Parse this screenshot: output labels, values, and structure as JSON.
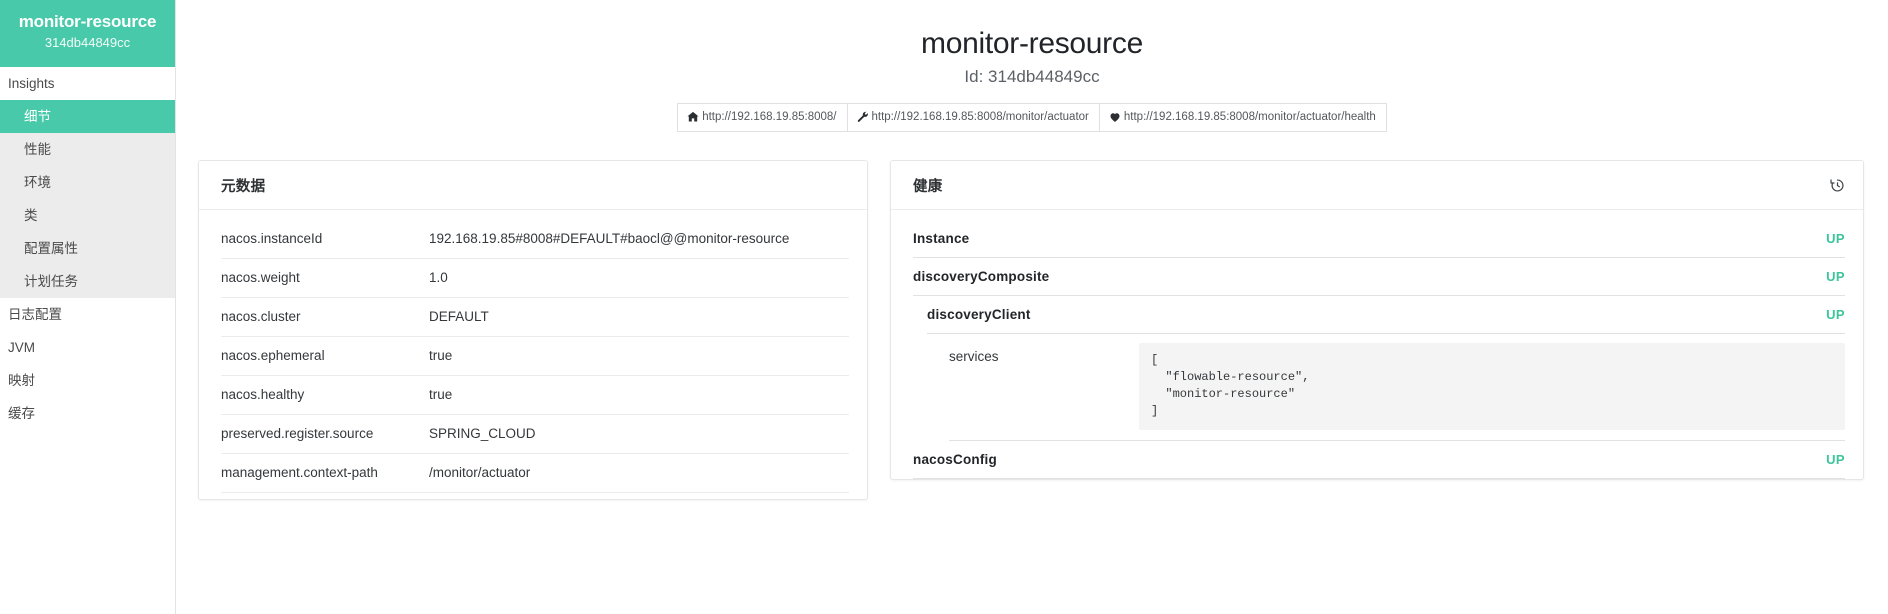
{
  "sidebar": {
    "brand": {
      "title": "monitor-resource",
      "id": "314db44849cc"
    },
    "section_label": "Insights",
    "insight_items": [
      {
        "label": "细节",
        "active": true
      },
      {
        "label": "性能",
        "active": false
      },
      {
        "label": "环境",
        "active": false
      },
      {
        "label": "类",
        "active": false
      },
      {
        "label": "配置属性",
        "active": false
      },
      {
        "label": "计划任务",
        "active": false
      }
    ],
    "top_items": [
      {
        "label": "日志配置"
      },
      {
        "label": "JVM"
      },
      {
        "label": "映射"
      },
      {
        "label": "缓存"
      }
    ]
  },
  "header": {
    "title": "monitor-resource",
    "subtitle": "Id: 314db44849cc",
    "links": [
      {
        "icon": "home-icon",
        "label": "http://192.168.19.85:8008/"
      },
      {
        "icon": "wrench-icon",
        "label": "http://192.168.19.85:8008/monitor/actuator"
      },
      {
        "icon": "heart-icon",
        "label": "http://192.168.19.85:8008/monitor/actuator/health"
      }
    ]
  },
  "metadata_panel": {
    "title": "元数据",
    "rows": [
      {
        "key": "nacos.instanceId",
        "value": "192.168.19.85#8008#DEFAULT#baocl@@monitor-resource"
      },
      {
        "key": "nacos.weight",
        "value": "1.0"
      },
      {
        "key": "nacos.cluster",
        "value": "DEFAULT"
      },
      {
        "key": "nacos.ephemeral",
        "value": "true"
      },
      {
        "key": "nacos.healthy",
        "value": "true"
      },
      {
        "key": "preserved.register.source",
        "value": "SPRING_CLOUD"
      },
      {
        "key": "management.context-path",
        "value": "/monitor/actuator"
      }
    ]
  },
  "health_panel": {
    "title": "健康",
    "history_icon": "history-icon",
    "rows": [
      {
        "name": "Instance",
        "status": "UP",
        "level": 0
      },
      {
        "name": "discoveryComposite",
        "status": "UP",
        "level": 1
      },
      {
        "name": "discoveryClient",
        "status": "UP",
        "level": 2
      }
    ],
    "detail": {
      "key": "services",
      "value": "[\n  \"flowable-resource\",\n  \"monitor-resource\"\n]"
    },
    "last_row": {
      "name": "nacosConfig",
      "status": "UP",
      "level": 1
    }
  },
  "colors": {
    "brand": "#48c9a9",
    "status_up": "#3ec49b",
    "sidebar_sub_bg": "#ececec"
  }
}
